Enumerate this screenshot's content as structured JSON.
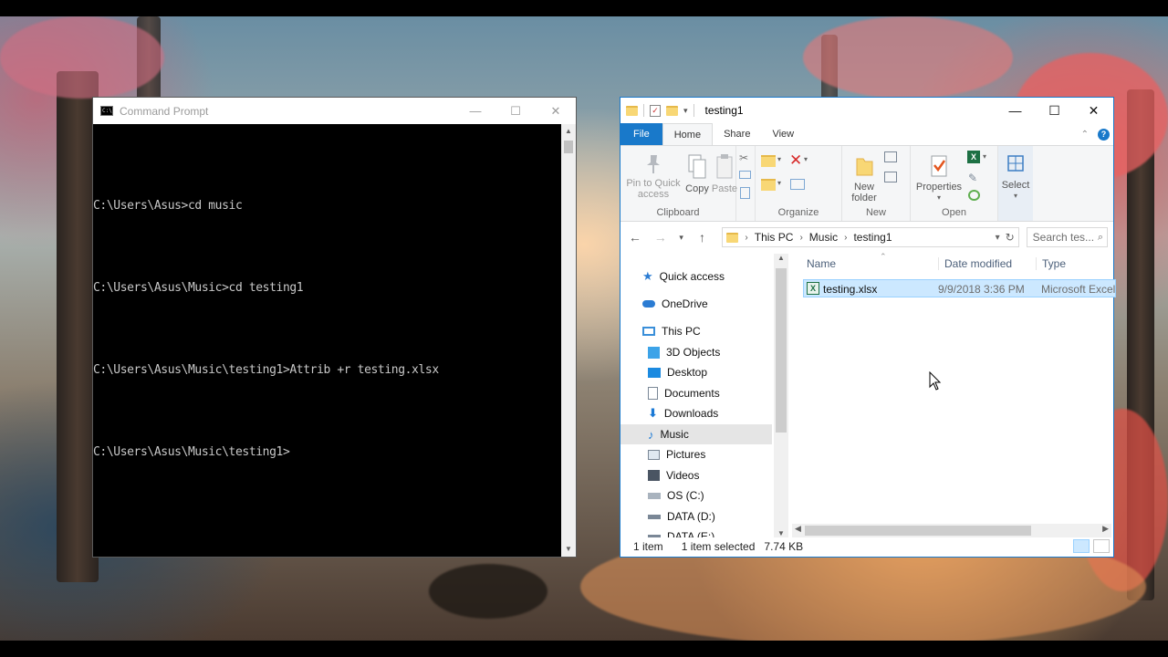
{
  "desktop": {
    "wallpaper": "autumn-forest"
  },
  "cmd": {
    "title": "Command Prompt",
    "icon": "cmd-icon",
    "icon_text": "C:\\",
    "lines": [
      "C:\\Users\\Asus>cd music",
      "C:\\Users\\Asus\\Music>cd testing1",
      "C:\\Users\\Asus\\Music\\testing1>Attrib +r testing.xlsx",
      "C:\\Users\\Asus\\Music\\testing1>"
    ]
  },
  "window_controls": {
    "minimize": "—",
    "maximize": "☐",
    "close": "✕"
  },
  "explorer": {
    "title": "testing1",
    "tabs": [
      "File",
      "Home",
      "Share",
      "View"
    ],
    "active_tab": "Home",
    "accent": "#1979ca",
    "ribbon": {
      "clipboard": {
        "label": "Clipboard",
        "pin": "Pin to Quick access",
        "copy": "Copy",
        "paste": "Paste"
      },
      "organize": {
        "label": "Organize"
      },
      "new": {
        "label": "New",
        "new_folder": "New folder"
      },
      "open": {
        "label": "Open",
        "properties": "Properties"
      },
      "select": {
        "label": "Select"
      }
    },
    "breadcrumb": [
      "This PC",
      "Music",
      "testing1"
    ],
    "search_placeholder": "Search tes...",
    "nav": {
      "quick_access": "Quick access",
      "onedrive": "OneDrive",
      "this_pc": "This PC",
      "objects3d": "3D Objects",
      "desktop": "Desktop",
      "documents": "Documents",
      "downloads": "Downloads",
      "music": "Music",
      "pictures": "Pictures",
      "videos": "Videos",
      "os_c": "OS (C:)",
      "data_d": "DATA (D:)",
      "data_e": "DATA (E:)"
    },
    "selected_nav": "Music",
    "columns": {
      "name": "Name",
      "date": "Date modified",
      "type": "Type"
    },
    "files": [
      {
        "name": "testing.xlsx",
        "date": "9/9/2018 3:36 PM",
        "type": "Microsoft Excel"
      }
    ],
    "status": {
      "count": "1 item",
      "selected": "1 item selected",
      "size": "7.74 KB"
    }
  }
}
